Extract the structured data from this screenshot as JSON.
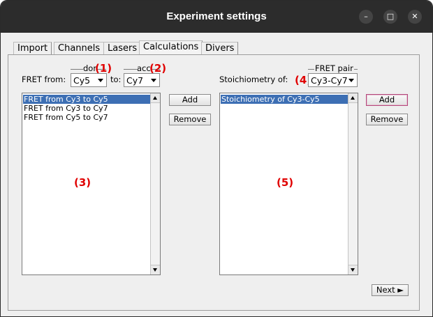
{
  "window": {
    "title": "Experiment settings",
    "controls": {
      "minimize": "–",
      "maximize": "□",
      "close": "✕"
    }
  },
  "tabs": [
    {
      "label": "Import",
      "active": false
    },
    {
      "label": "Channels",
      "active": false
    },
    {
      "label": "Lasers",
      "active": false
    },
    {
      "label": "Calculations",
      "active": true
    },
    {
      "label": "Divers",
      "active": false
    }
  ],
  "fret": {
    "from_label": "FRET from:",
    "to_label": "to:",
    "donor_title": "donor",
    "acceptor_title": "acceptor",
    "donor_value": "Cy5",
    "acceptor_value": "Cy7",
    "add_label": "Add",
    "remove_label": "Remove",
    "list_items": [
      "FRET from Cy3 to Cy5",
      "FRET from Cy3 to Cy7",
      "FRET from Cy5 to Cy7"
    ],
    "selected_index": 0
  },
  "stoichiometry": {
    "of_label": "Stoichiometry of:",
    "pair_title": "FRET pair",
    "pair_value": "Cy3-Cy7",
    "add_label": "Add",
    "remove_label": "Remove",
    "list_items": [
      "Stoichiometry of Cy3-Cy5"
    ],
    "selected_index": 0
  },
  "annotations": {
    "a1": "(1)",
    "a2": "(2)",
    "a3": "(3)",
    "a4": "(4)",
    "a5": "(5)"
  },
  "footer": {
    "next_label": "Next ►"
  },
  "colors": {
    "selection": "#3d6fb4",
    "annotation": "#e00000",
    "titlebar": "#2c2c2c"
  }
}
